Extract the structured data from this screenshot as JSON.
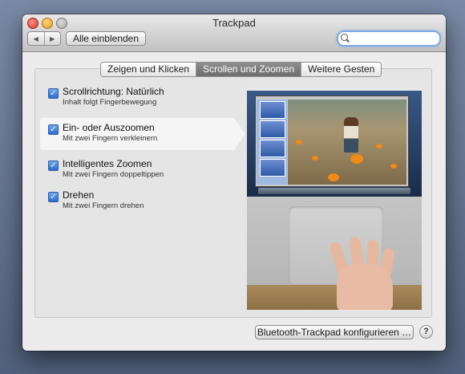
{
  "window": {
    "title": "Trackpad"
  },
  "toolbar": {
    "back_glyph": "◀",
    "forward_glyph": "▶",
    "show_all_label": "Alle einblenden",
    "search": {
      "value": "",
      "placeholder": ""
    }
  },
  "tabs": [
    {
      "label": "Zeigen und Klicken",
      "selected": false
    },
    {
      "label": "Scrollen und Zoomen",
      "selected": true
    },
    {
      "label": "Weitere Gesten",
      "selected": false
    }
  ],
  "options": [
    {
      "title": "Scrollrichtung: Natürlich",
      "subtitle": "Inhalt folgt Fingerbewegung",
      "checked": true
    },
    {
      "title": "Ein- oder Auszoomen",
      "subtitle": "Mit zwei Fingern verkleinern",
      "checked": true
    },
    {
      "title": "Intelligentes Zoomen",
      "subtitle": "Mit zwei Fingern doppeltippen",
      "checked": true
    },
    {
      "title": "Drehen",
      "subtitle": "Mit zwei Fingern drehen",
      "checked": true
    }
  ],
  "check_glyph": "✓",
  "footer": {
    "bluetooth_label": "Bluetooth-Trackpad konfigurieren …",
    "help_label": "?"
  },
  "colors": {
    "selected_tab": "#7a7a7a",
    "checkbox": "#3b7bd6",
    "close": "#e0443a",
    "minimize": "#e6a62a"
  }
}
